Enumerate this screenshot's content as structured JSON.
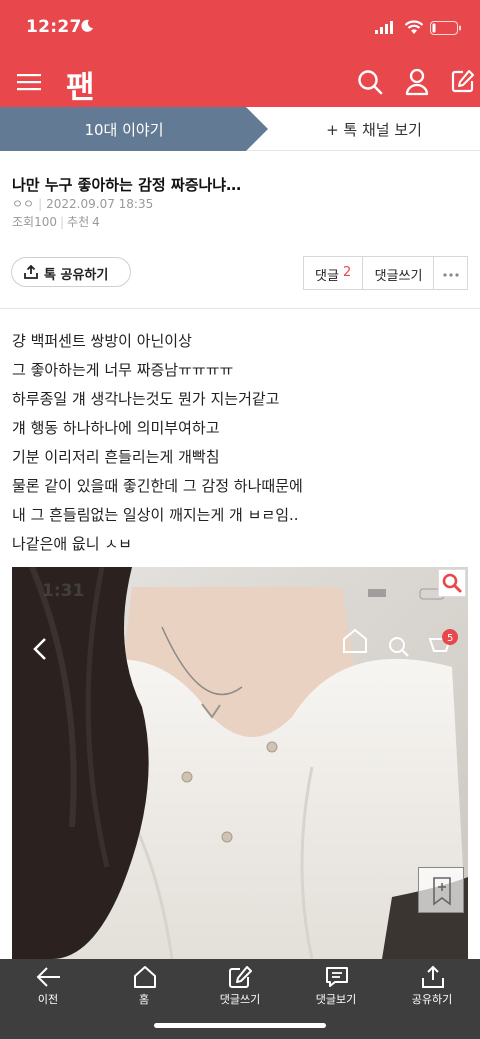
{
  "status_bar": {
    "time": "12:27"
  },
  "header": {
    "logo": "팬",
    "icons": [
      "menu-icon",
      "search-icon",
      "user-icon",
      "write-icon"
    ],
    "brand_color": "#e8474c"
  },
  "channel_bar": {
    "current": "10대 이야기",
    "other": "+ 톡 채널 보기"
  },
  "post": {
    "title": "나만 누구 좋아하는 감정 짜증나냐…",
    "author": "ㅇㅇ",
    "date": "2022.09.07 18:35",
    "views_label": "조회",
    "views": "100",
    "recommend_label": "추천",
    "recommend": "4",
    "body_lines": [
      "걍 백퍼센트 쌍방이 아닌이상",
      "그 좋아하는게 너무 짜증남ㅠㅠㅠㅠ",
      "하루종일 걔 생각나는것도 뭔가 지는거같고",
      "걔 행동 하나하나에 의미부여하고",
      "기분 이리저리 흔들리는게 개빡침",
      "물론 같이 있을때 좋긴한데 그 감정 하나때문에",
      "내 그 흔들림없는 일상이 깨지는게 개 ㅂㄹ임..",
      "나같은애 읎니 ㅅㅂ"
    ],
    "image_overlay_time": "1:31"
  },
  "actions": {
    "share": "톡 공유하기",
    "comments_label": "댓글",
    "comments_count": "2",
    "write_comment": "댓글쓰기"
  },
  "bottom_nav": [
    {
      "label": "이전",
      "icon": "back-arrow-icon"
    },
    {
      "label": "홈",
      "icon": "home-icon"
    },
    {
      "label": "댓글쓰기",
      "icon": "edit-comment-icon"
    },
    {
      "label": "댓글보기",
      "icon": "view-comments-icon"
    },
    {
      "label": "공유하기",
      "icon": "share-icon"
    }
  ]
}
